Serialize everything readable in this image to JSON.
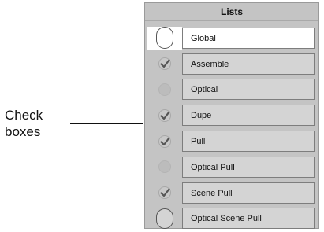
{
  "callout": {
    "line1": "Check",
    "line2": "boxes"
  },
  "panel": {
    "title": "Lists",
    "items": [
      {
        "label": "Global",
        "checked": false,
        "selected": true
      },
      {
        "label": "Assemble",
        "checked": true,
        "selected": false
      },
      {
        "label": "Optical",
        "checked": false,
        "selected": false
      },
      {
        "label": "Dupe",
        "checked": true,
        "selected": false
      },
      {
        "label": "Pull",
        "checked": true,
        "selected": false
      },
      {
        "label": "Optical Pull",
        "checked": false,
        "selected": false
      },
      {
        "label": "Scene Pull",
        "checked": true,
        "selected": false
      },
      {
        "label": "Optical Scene Pull",
        "checked": false,
        "selected": false
      }
    ]
  },
  "icons": {
    "checked": "checkmark-icon",
    "unchecked": "empty-circle-icon"
  }
}
